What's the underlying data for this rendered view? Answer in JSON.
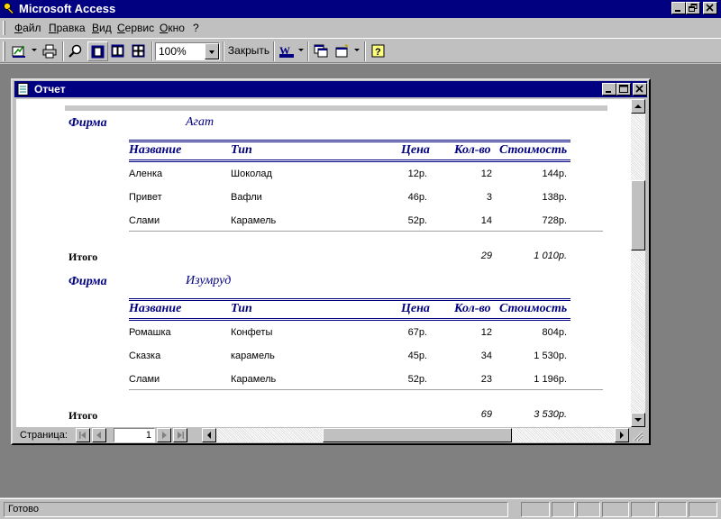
{
  "app": {
    "title": "Microsoft Access"
  },
  "menu": [
    "Файл",
    "Правка",
    "Вид",
    "Сервис",
    "Окно",
    "?"
  ],
  "toolbar": {
    "zoom_value": "100%",
    "close_label": "Закрыть"
  },
  "report_window": {
    "title": "Отчет"
  },
  "report": {
    "firm_label": "Фирма",
    "headers": {
      "name": "Название",
      "type": "Тип",
      "price": "Цена",
      "qty": "Кол-во",
      "cost": "Стоимость"
    },
    "total_label": "Итого",
    "groups": [
      {
        "firm": "Агат",
        "rows": [
          {
            "name": "Аленка",
            "type": "Шоколад",
            "price": "12р.",
            "qty": "12",
            "cost": "144р."
          },
          {
            "name": "Привет",
            "type": "Вафли",
            "price": "46р.",
            "qty": "3",
            "cost": "138р."
          },
          {
            "name": "Слами",
            "type": "Карамель",
            "price": "52р.",
            "qty": "14",
            "cost": "728р."
          }
        ],
        "total_qty": "29",
        "total_cost": "1 010р."
      },
      {
        "firm": "Изумруд",
        "rows": [
          {
            "name": "Ромашка",
            "type": "Конфеты",
            "price": "67р.",
            "qty": "12",
            "cost": "804р."
          },
          {
            "name": "Сказка",
            "type": "карамель",
            "price": "45р.",
            "qty": "34",
            "cost": "1 530р."
          },
          {
            "name": "Слами",
            "type": "Карамель",
            "price": "52р.",
            "qty": "23",
            "cost": "1 196р."
          }
        ],
        "total_qty": "69",
        "total_cost": "3 530р."
      }
    ]
  },
  "navigation": {
    "page_label": "Страница:",
    "page_value": "1"
  },
  "status": {
    "text": "Готово"
  }
}
